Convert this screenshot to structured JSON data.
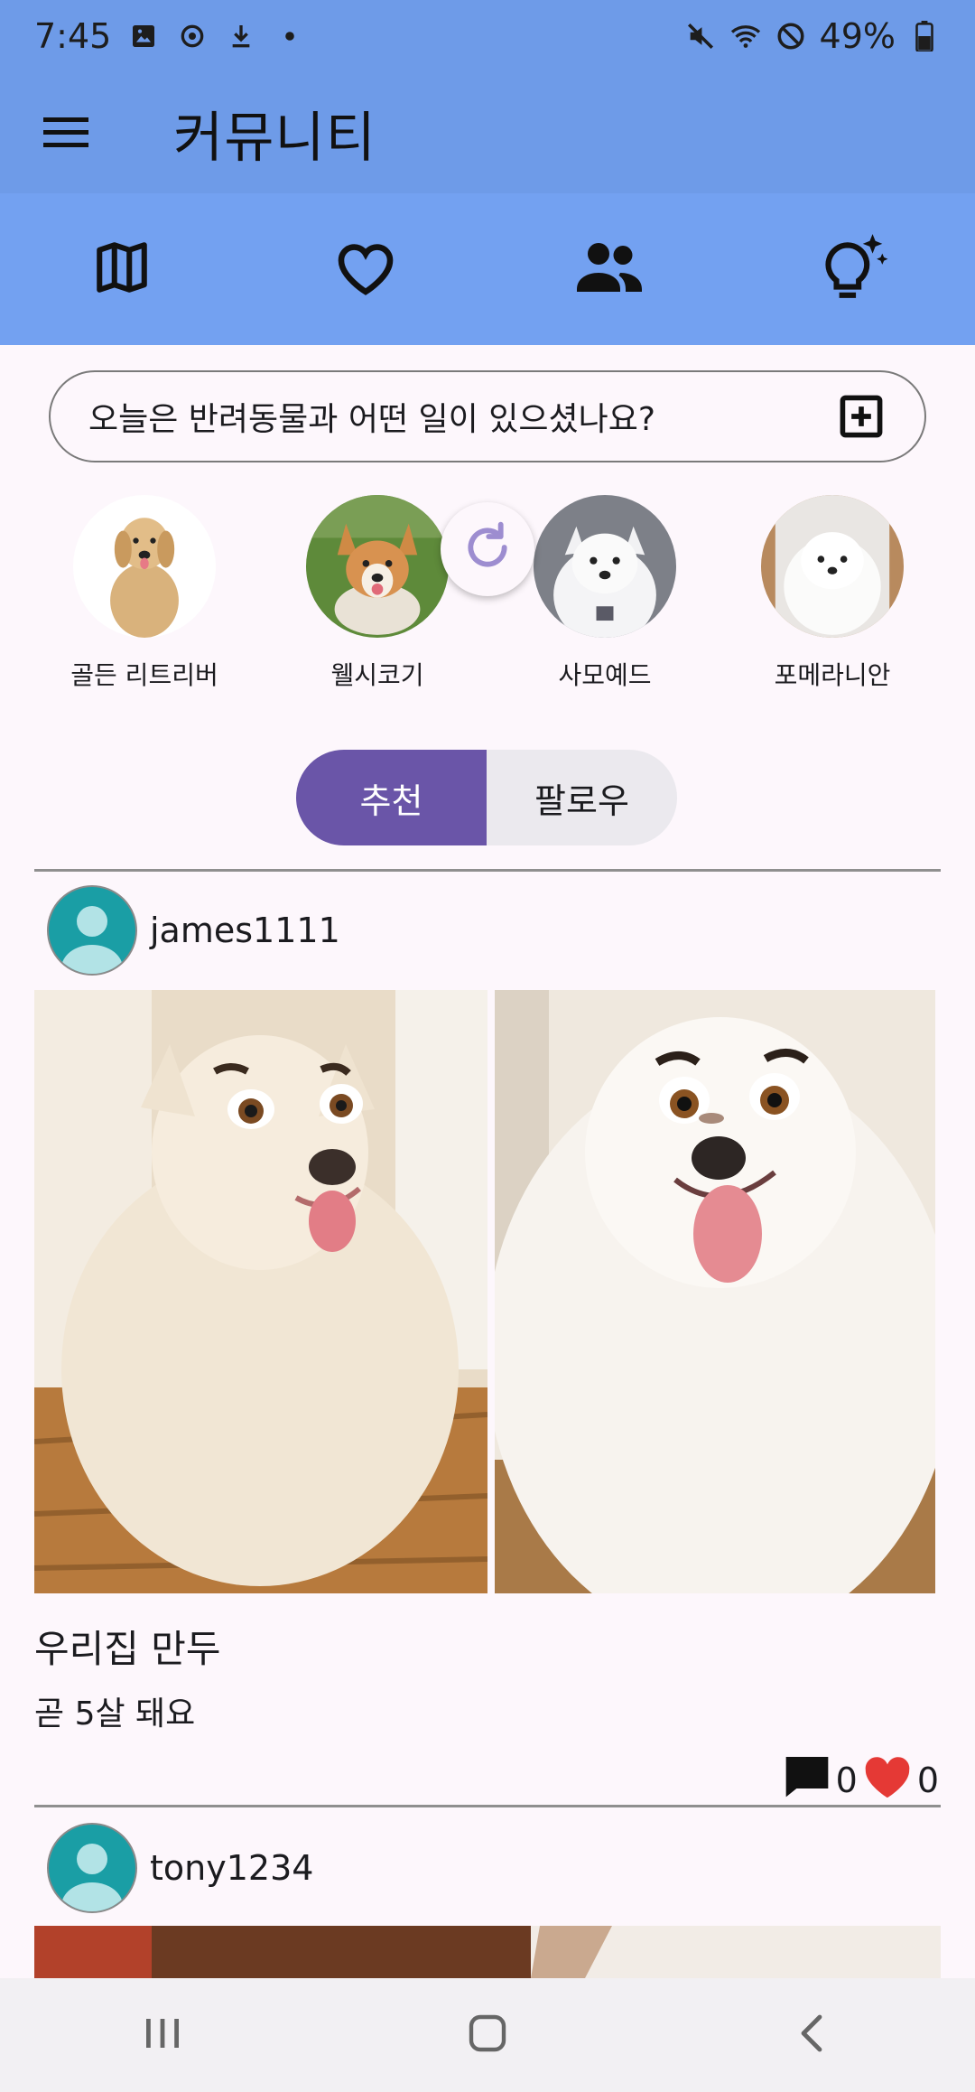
{
  "status_bar": {
    "time": "7:45",
    "battery": "49%"
  },
  "app_bar": {
    "title": "커뮤니티"
  },
  "nav_tabs": [
    {
      "icon": "map-icon"
    },
    {
      "icon": "heart-outline-icon"
    },
    {
      "icon": "people-icon"
    },
    {
      "icon": "lightbulb-sparkle-icon"
    }
  ],
  "composer": {
    "placeholder": "오늘은 반려동물과 어떤 일이 있으셨나요?",
    "icon": "add-box-icon"
  },
  "breeds": [
    {
      "label": "골든 리트리버"
    },
    {
      "label": "웰시코기"
    },
    {
      "label": "사모예드"
    },
    {
      "label": "포메라니안"
    }
  ],
  "segments": {
    "recommended": "추천",
    "following": "팔로우",
    "selected": "추천"
  },
  "posts": [
    {
      "username": "james1111",
      "title": "우리집 만두",
      "body": "곧 5살 돼요",
      "comments": "0",
      "likes": "0"
    },
    {
      "username": "tony1234"
    }
  ],
  "colors": {
    "app_bar": "#6e9be8",
    "nav_tabs": "#73a1f1",
    "segment_active": "#6a55a8",
    "like": "#e53935",
    "avatar": "#1a9ea5"
  }
}
